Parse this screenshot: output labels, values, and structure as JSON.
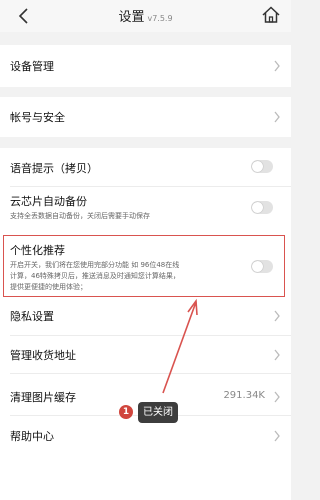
{
  "header": {
    "title": "设置",
    "version": "v7.5.9"
  },
  "settings": {
    "device_management": "设备管理",
    "account_security": "帐号与安全",
    "voice_prompt": "语音提示（拷贝）",
    "cloud_backup": {
      "label": "云芯片自动备份",
      "description": "支持全丢数据自动备份，关闭后需要手动保存"
    },
    "personalized": {
      "label": "个性化推荐",
      "description_lines": [
        "开启开关，我们将在您使用完部分功能 如 96位48在线",
        "计算，46特殊拷贝后，推送消息及时通知您计算结果，",
        "提供更便捷的使用体验；"
      ]
    },
    "privacy": "隐私设置",
    "shipping_address": "管理收货地址",
    "clear_cache": {
      "label": "清理图片缓存",
      "value": "291.34K"
    },
    "help_center": "帮助中心"
  },
  "toast": {
    "badge": "1",
    "text": "已关闭"
  },
  "colors": {
    "highlight": "#d9534f",
    "badge": "#d0453d",
    "toast_bg": "#3d3d3d"
  }
}
